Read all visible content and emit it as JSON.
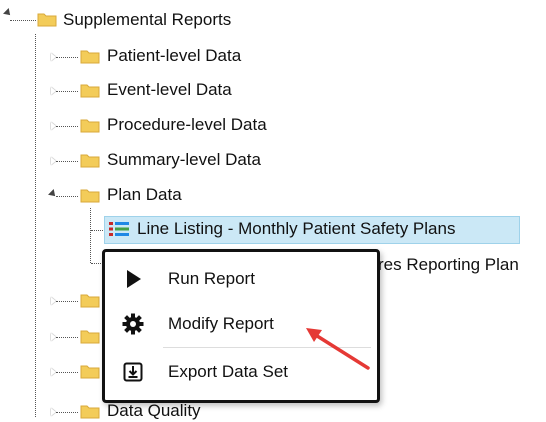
{
  "tree": {
    "root": {
      "label": "Supplemental Reports"
    },
    "children": [
      {
        "label": "Patient-level Data"
      },
      {
        "label": "Event-level Data"
      },
      {
        "label": "Procedure-level Data"
      },
      {
        "label": "Summary-level Data"
      },
      {
        "label": "Plan Data"
      }
    ],
    "plan_children": [
      {
        "label": "Line Listing - Monthly Patient Safety Plans"
      },
      {
        "label": "res Reporting Plan"
      }
    ],
    "partially_hidden": {
      "label": "Data Quality"
    }
  },
  "context_menu": {
    "items": [
      {
        "label": "Run Report",
        "icon": "play-icon"
      },
      {
        "label": "Modify Report",
        "icon": "gear-icon"
      },
      {
        "label": "Export Data Set",
        "icon": "export-icon"
      }
    ]
  },
  "colors": {
    "folder": "#f3cc59",
    "selection": "#cbe8f6",
    "annotation_arrow": "#e53935"
  }
}
